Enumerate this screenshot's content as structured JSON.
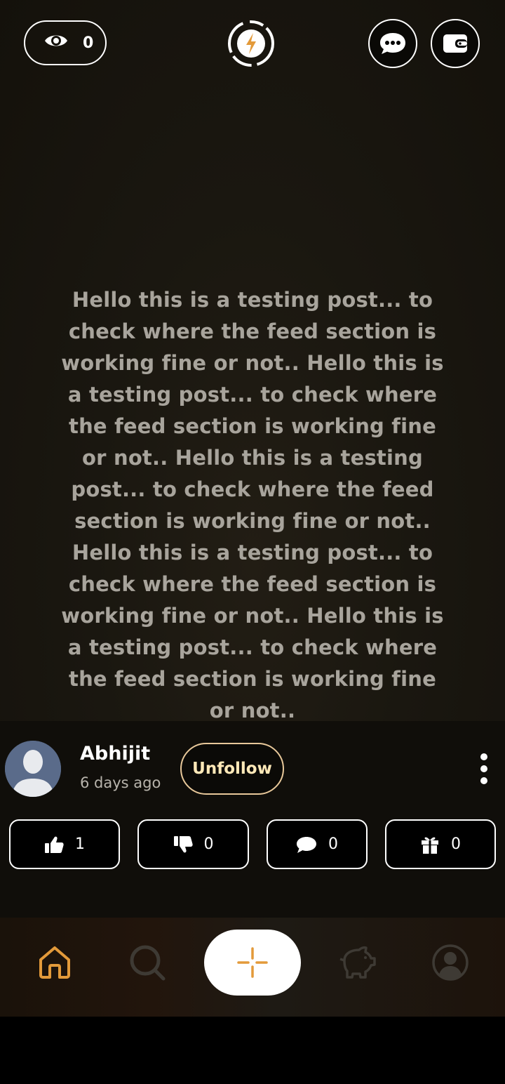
{
  "header": {
    "views_count": "0",
    "icons": [
      "eye-icon",
      "lightning-icon",
      "chat-icon",
      "wallet-icon"
    ]
  },
  "post": {
    "text": "Hello this is a testing post... to check where the feed section is working fine or not.. Hello this is a testing post... to check where the feed section is working fine or not.. Hello this is a testing post... to check where the feed section is working fine or not.. Hello this is a testing post... to check where the feed section is working fine or not.. Hello this is a testing post... to check where the feed section is working fine or not.."
  },
  "author": {
    "name": "Abhijit",
    "time": "6 days ago",
    "follow_label": "Unfollow"
  },
  "actions": {
    "likes": "1",
    "dislikes": "0",
    "comments": "0",
    "gifts": "0"
  },
  "nav": {
    "items": [
      "home-icon",
      "search-icon",
      "add-icon",
      "piggy-bank-icon",
      "profile-icon"
    ],
    "active": "home"
  },
  "colors": {
    "accent": "#e39a3a",
    "unfollow_border": "#e8c89a",
    "post_text": "#a8a49c"
  }
}
